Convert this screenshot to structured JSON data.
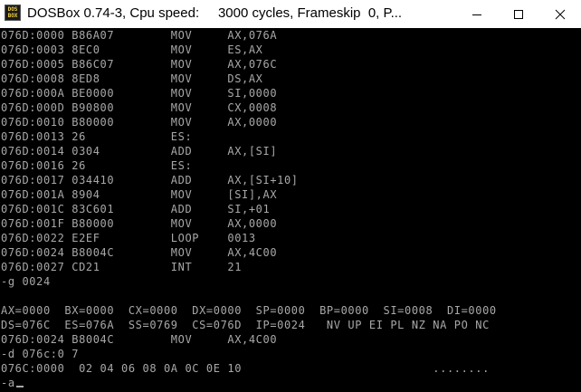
{
  "window": {
    "title": "DOSBox 0.74-3, Cpu speed:     3000 cycles, Frameskip  0, P...",
    "icon_text_top": "DOS",
    "icon_text_bottom": "BOX",
    "icon": "dosbox-icon",
    "controls": {
      "minimize": "minimize-icon",
      "maximize": "maximize-icon",
      "close": "close-icon"
    }
  },
  "console": {
    "lines": [
      "076D:0000 B86A07        MOV     AX,076A",
      "076D:0003 8EC0          MOV     ES,AX",
      "076D:0005 B86C07        MOV     AX,076C",
      "076D:0008 8ED8          MOV     DS,AX",
      "076D:000A BE0000        MOV     SI,0000",
      "076D:000D B90800        MOV     CX,0008",
      "076D:0010 B80000        MOV     AX,0000",
      "076D:0013 26            ES:",
      "076D:0014 0304          ADD     AX,[SI]",
      "076D:0016 26            ES:",
      "076D:0017 034410        ADD     AX,[SI+10]",
      "076D:001A 8904          MOV     [SI],AX",
      "076D:001C 83C601        ADD     SI,+01",
      "076D:001F B80000        MOV     AX,0000",
      "076D:0022 E2EF          LOOP    0013",
      "076D:0024 B8004C        MOV     AX,4C00",
      "076D:0027 CD21          INT     21",
      "-g 0024",
      "",
      "AX=0000  BX=0000  CX=0000  DX=0000  SP=0000  BP=0000  SI=0008  DI=0000",
      "DS=076C  ES=076A  SS=0769  CS=076D  IP=0024   NV UP EI PL NZ NA PO NC",
      "076D:0024 B8004C        MOV     AX,4C00",
      "-d 076c:0 7",
      "076C:0000  02 04 06 08 0A 0C 0E 10                           ........",
      "-a"
    ],
    "colors": {
      "background": "#000000",
      "text": "#a8a8a8"
    }
  }
}
